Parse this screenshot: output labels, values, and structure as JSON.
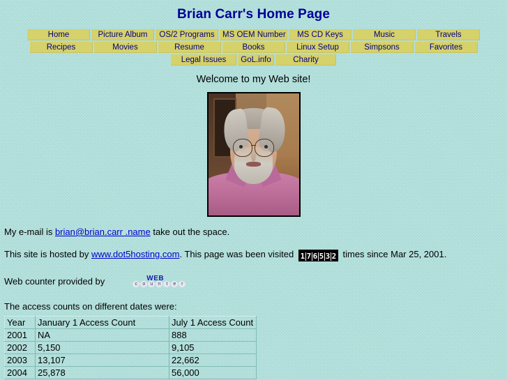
{
  "page": {
    "title": "Brian Carr's Home Page",
    "welcome": "Welcome to my Web site!"
  },
  "colors": {
    "background": "#a6dbd6",
    "button": "#d5d16b",
    "button_text": "#000080",
    "title_text": "#000099",
    "link": "#0000cc",
    "counter_bg": "#000000",
    "counter_digit": "#ffffff",
    "table_border": "#c9ece8"
  },
  "nav": {
    "row1": [
      {
        "label": "Home"
      },
      {
        "label": "Picture Album"
      },
      {
        "label": "OS/2 Programs"
      },
      {
        "label": "MS OEM Number"
      },
      {
        "label": "MS CD Keys"
      },
      {
        "label": "Music"
      },
      {
        "label": "Travels"
      }
    ],
    "row2": [
      {
        "label": "Recipes"
      },
      {
        "label": "Movies"
      },
      {
        "label": "Resume"
      },
      {
        "label": "Books"
      },
      {
        "label": "Linux Setup"
      },
      {
        "label": "Simpsons"
      },
      {
        "label": "Favorites"
      }
    ],
    "row3": [
      {
        "label": "Legal Issues"
      },
      {
        "label": "GoL.info"
      },
      {
        "label": "Charity"
      }
    ]
  },
  "photo": {
    "alt": "Portrait photo of Brian Carr"
  },
  "email_line": {
    "prefix": "My e-mail is ",
    "address": "brian@brian.carr .name",
    "suffix": " take out the space."
  },
  "host_line": {
    "prefix": "This site is hosted by ",
    "host": "www.dot5hosting.com",
    "mid": ". This page was been visited ",
    "counter": "176532",
    "suffix": " times since Mar 25, 2001."
  },
  "webcounter_line": {
    "text": "Web counter provided by",
    "logo_top": "WEB",
    "logo_bottom": [
      "c",
      "o",
      "u",
      "n",
      "t",
      "e",
      "r"
    ]
  },
  "access_intro": "The access counts on different dates were:",
  "table": {
    "headers": [
      "Year",
      "January 1 Access Count",
      "July 1 Access Count"
    ],
    "rows": [
      [
        "2001",
        "NA",
        "888"
      ],
      [
        "2002",
        "5,150",
        "9,105"
      ],
      [
        "2003",
        "13,107",
        "22,662"
      ],
      [
        "2004",
        "25,878",
        "56,000"
      ]
    ]
  }
}
